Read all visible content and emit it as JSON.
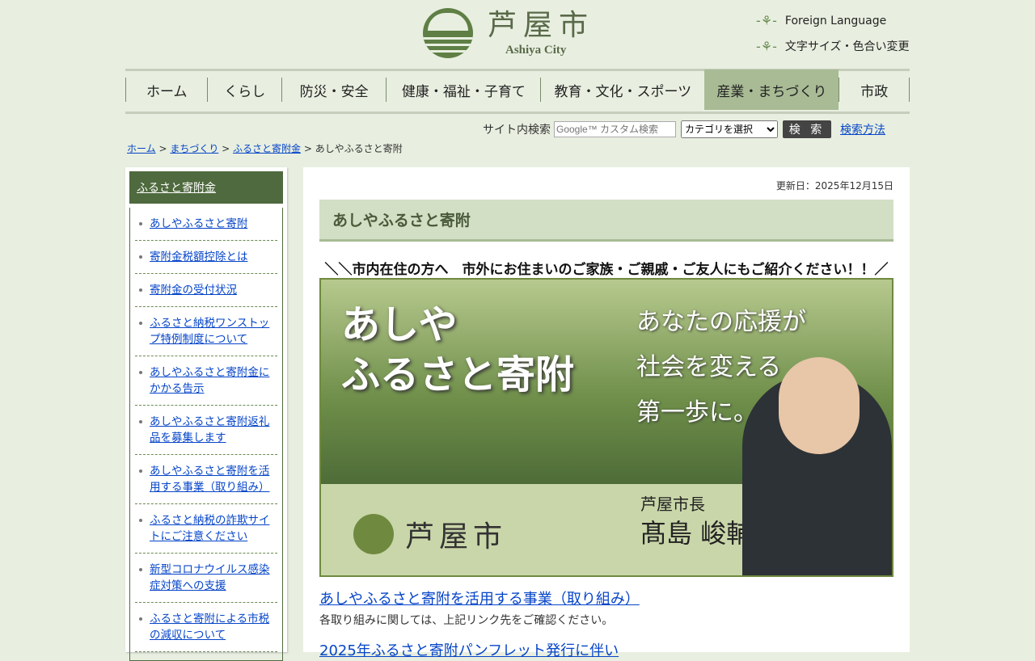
{
  "header": {
    "logo_ja": "芦屋市",
    "logo_en": "Ashiya City",
    "utility": [
      "Foreign Language",
      "文字サイズ・色合い変更"
    ]
  },
  "nav": [
    "ホーム",
    "くらし",
    "防災・安全",
    "健康・福祉・子育て",
    "教育・文化・スポーツ",
    "産業・まちづくり",
    "市政"
  ],
  "search": {
    "label": "サイト内検索",
    "placeholder": "Google™ カスタム検索",
    "category": "カテゴリを選択",
    "button": "検 索",
    "help": "検索方法"
  },
  "breadcrumb": [
    "ホーム",
    "まちづくり",
    "ふるさと寄附金",
    "あしやふるさと寄附"
  ],
  "sidebar": {
    "title": "ふるさと寄附金",
    "items": [
      "あしやふるさと寄附",
      "寄附金税額控除とは",
      "寄附金の受付状況",
      "ふるさと納税ワンストップ特例制度について",
      "あしやふるさと寄附金にかかる告示",
      "あしやふるさと寄附返礼品を募集します",
      "あしやふるさと寄附を活用する事業（取り組み）",
      "ふるさと納税の詐欺サイトにご注意ください",
      "新型コロナウイルス感染症対策への支援",
      "ふるさと寄附による市税の減収について"
    ]
  },
  "main": {
    "updated": "更新日：2025年12月15日",
    "title": "あしやふるさと寄附",
    "tagline": "＼＼市内在住の方へ　市外にお住まいのご家族・ご親戚・ご友人にもご紹介ください！！／／",
    "banner": {
      "title1": "あしや",
      "title2": "ふるさと寄附",
      "slogan": [
        "あなたの応援が",
        "社会を変える",
        "第一歩に。"
      ],
      "city": "芦屋市",
      "mayor_title": "芦屋市長",
      "mayor_name": "髙島 峻輔"
    },
    "link1": "あしやふるさと寄附を活用する事業（取り組み）",
    "desc1": "各取り組みに関しては、上記リンク先をご確認ください。",
    "link2": "2025年ふるさと寄附パンフレット発行に伴い"
  }
}
